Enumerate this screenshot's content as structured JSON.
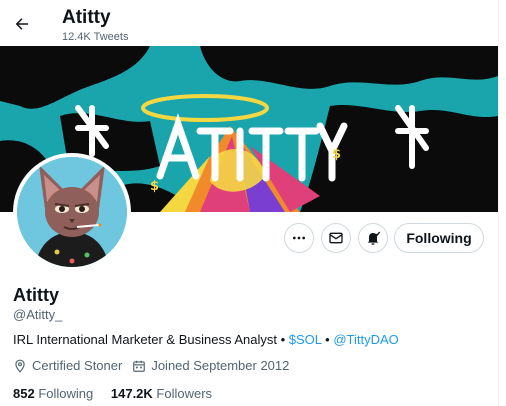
{
  "header": {
    "title": "Atitty",
    "tweet_count": "12.4K Tweets"
  },
  "banner": {
    "graffiti_text": "ATITTY",
    "colors": {
      "teal": "#1aa5ad",
      "black": "#0b0b0b",
      "yellow": "#f5d742",
      "orange": "#f08a2b",
      "pink": "#e0407a"
    }
  },
  "actions": {
    "follow_label": "Following"
  },
  "profile": {
    "name": "Atitty",
    "handle": "@Atitty_",
    "bio_prefix": "IRL International Marketer & Business Analyst • ",
    "bio_link_1": "$SOL",
    "bio_sep": " • ",
    "bio_link_2": "@TittyDAO",
    "location": "Certified Stoner",
    "joined": "Joined September 2012",
    "following_count": "852",
    "following_label": "Following",
    "followers_count": "147.2K",
    "followers_label": "Followers"
  },
  "colors": {
    "link": "#1d9bf0",
    "secondary_text": "#536471",
    "primary_text": "#0f1419",
    "border": "#cfd9de"
  }
}
